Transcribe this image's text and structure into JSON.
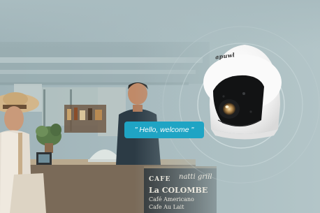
{
  "bubble": {
    "text": "\" Hello, welcome \""
  },
  "camera": {
    "brand": "apuwl"
  },
  "chalkboard": {
    "cafe": "CAFE",
    "script": "natti grill",
    "colombe": "La COLOMBE",
    "line2": "Café Americano",
    "line3": "Cafe Au Lait"
  },
  "colors": {
    "backdrop": "#a9bcc0",
    "bubble": "#1fa4c4",
    "camera_body": "#f6f6f6",
    "camera_lens_ring": "#111111"
  }
}
